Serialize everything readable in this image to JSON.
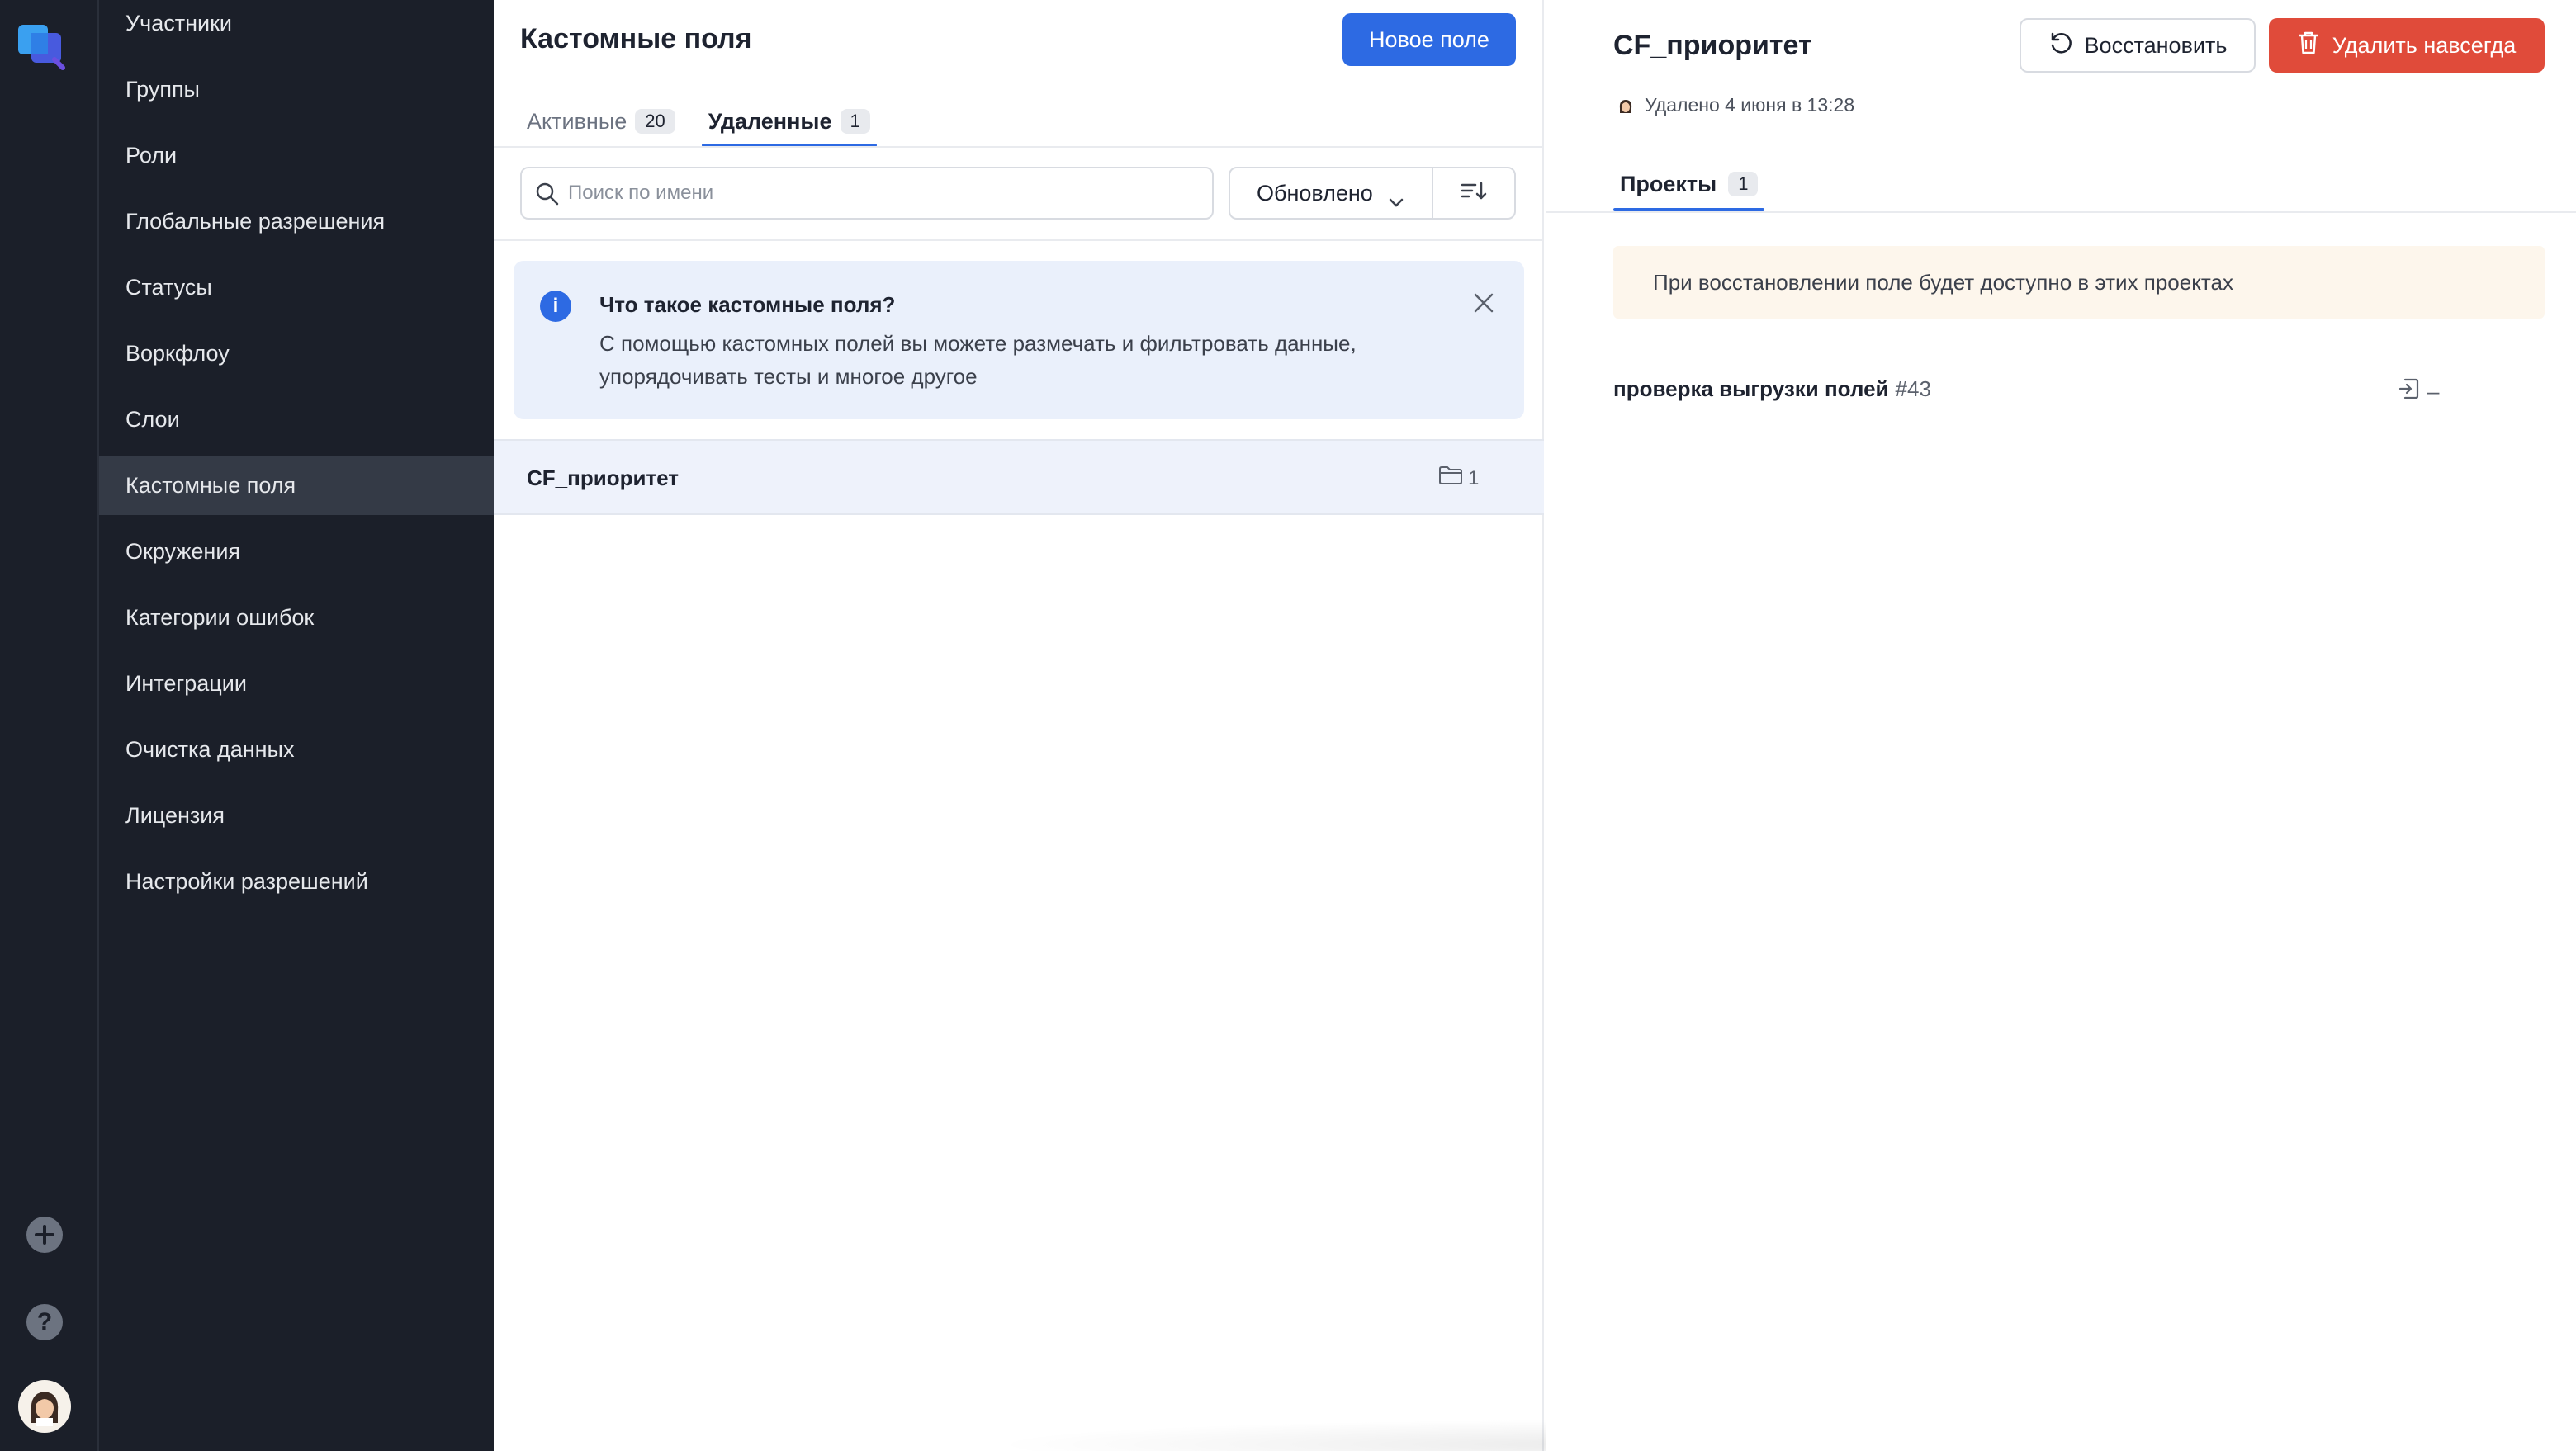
{
  "rail": {
    "logo_icon": "app-logo-icon",
    "add_icon": "plus-icon",
    "help_icon": "question-icon",
    "help_glyph": "?",
    "avatar_icon": "user-avatar"
  },
  "nav": {
    "items": [
      {
        "label": "Участники",
        "active": false
      },
      {
        "label": "Группы",
        "active": false
      },
      {
        "label": "Роли",
        "active": false
      },
      {
        "label": "Глобальные разрешения",
        "active": false
      },
      {
        "label": "Статусы",
        "active": false
      },
      {
        "label": "Воркфлоу",
        "active": false
      },
      {
        "label": "Слои",
        "active": false
      },
      {
        "label": "Кастомные поля",
        "active": true
      },
      {
        "label": "Окружения",
        "active": false
      },
      {
        "label": "Категории ошибок",
        "active": false
      },
      {
        "label": "Интеграции",
        "active": false
      },
      {
        "label": "Очистка данных",
        "active": false
      },
      {
        "label": "Лицензия",
        "active": false
      },
      {
        "label": "Настройки разрешений",
        "active": false
      }
    ]
  },
  "list": {
    "title": "Кастомные поля",
    "new_button": "Новое поле",
    "tabs": [
      {
        "label": "Активные",
        "count": "20",
        "active": false
      },
      {
        "label": "Удаленные",
        "count": "1",
        "active": true
      }
    ],
    "search": {
      "placeholder": "Поиск по имени",
      "value": ""
    },
    "sort": {
      "selected": "Обновлено"
    },
    "info": {
      "title": "Что такое кастомные поля?",
      "text": "С помощью кастомных полей вы можете размечать и фильтровать данные, упорядочивать тесты и многое другое",
      "icon_glyph": "i"
    },
    "rows": [
      {
        "name": "CF_приоритет",
        "projects": "1"
      }
    ]
  },
  "detail": {
    "title": "CF_приоритет",
    "restore_button": "Восстановить",
    "delete_button": "Удалить навсегда",
    "deleted_text": "Удалено 4 июня в 13:28",
    "tabs": [
      {
        "label": "Проекты",
        "count": "1"
      }
    ],
    "notice": "При восстановлении поле будет доступно в этих проектах",
    "projects": [
      {
        "name": "проверка выгрузки полей",
        "id": "#43",
        "status": "–"
      }
    ]
  },
  "colors": {
    "accent": "#2d6ae3",
    "danger": "#e04b3a",
    "sidebar_bg": "#1b1f29",
    "sidebar_active": "#343a46",
    "info_bg": "#eaf0fb",
    "notice_bg": "#fdf6ec"
  }
}
